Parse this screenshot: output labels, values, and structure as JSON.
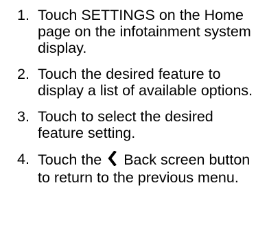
{
  "steps": [
    {
      "number": "1.",
      "text": "Touch SETTINGS on the Home page on the infotainment system display."
    },
    {
      "number": "2.",
      "text": "Touch the desired feature to display a list of available options."
    },
    {
      "number": "3.",
      "text": "Touch to select the desired feature setting."
    },
    {
      "number": "4.",
      "text_before": "Touch the",
      "icon": "back-chevron-icon",
      "text_after": "Back screen button to return to the previous menu."
    }
  ]
}
